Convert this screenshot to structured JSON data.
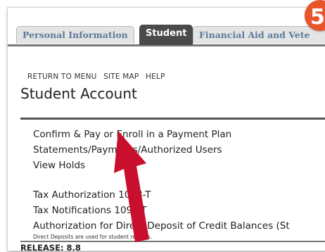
{
  "tabs": [
    {
      "label": "Personal Information"
    },
    {
      "label": "Student"
    },
    {
      "label": "Financial Aid and Vete"
    }
  ],
  "badge": {
    "label": "5",
    "color": "#e8552a"
  },
  "topnav": {
    "return": "RETURN TO MENU",
    "sitemap": "SITE MAP",
    "help": "HELP"
  },
  "page": {
    "title": "Student Account"
  },
  "links": [
    {
      "label": "Confirm & Pay or Enroll in a Payment Plan"
    },
    {
      "label": "Statements/Payments/Authorized Users"
    },
    {
      "label": "View Holds"
    },
    {
      "label": "Tax Authorization 1098-T"
    },
    {
      "label": "Tax Notifications 1098-T"
    },
    {
      "label": "Authorization for Direct Deposit of Credit Balances (St"
    }
  ],
  "note": "Direct Deposits are used for student refunds.",
  "release": "RELEASE: 8.8",
  "colors": {
    "arrow": "#c8102e",
    "active_tab": "#4a4a4a"
  }
}
